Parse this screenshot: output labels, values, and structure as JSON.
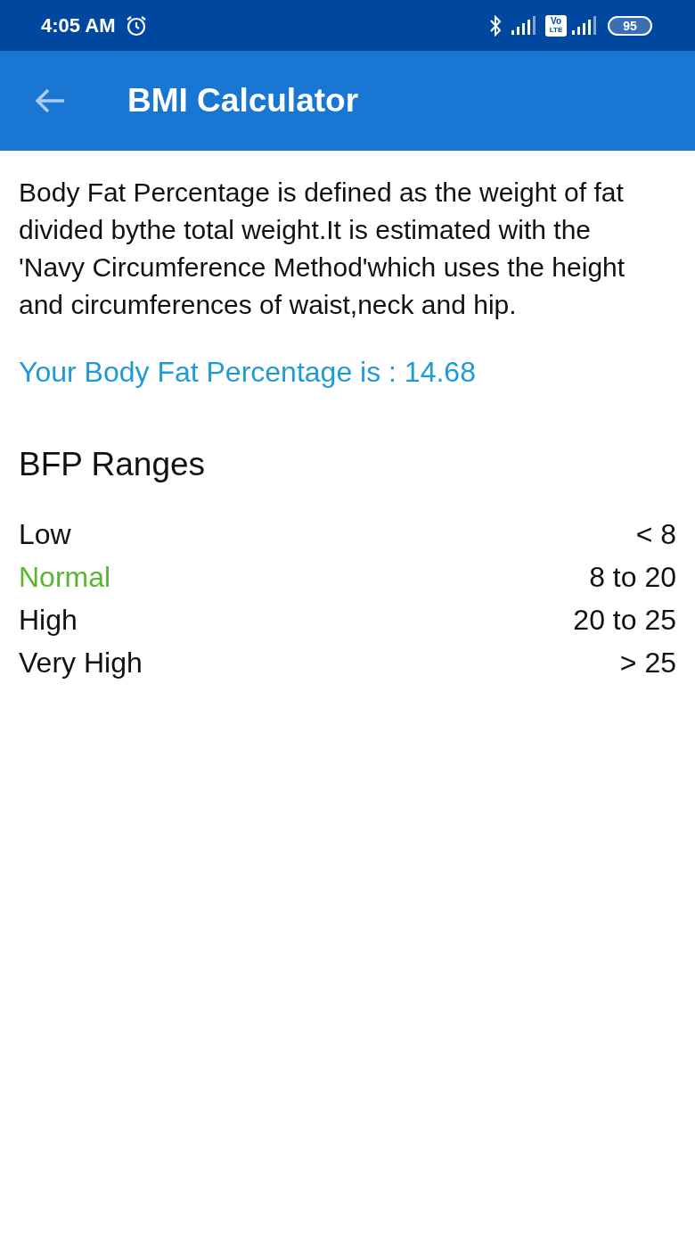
{
  "status_bar": {
    "time": "4:05 AM",
    "network_badge": [
      "Vo",
      "LTE"
    ],
    "battery": "95"
  },
  "app_bar": {
    "title": "BMI Calculator"
  },
  "description": "Body Fat Percentage is defined as the weight of fat divided bythe total weight.It is estimated with the 'Navy Circumference Method'which uses the height and circumferences of waist,neck and hip.",
  "result": "Your Body Fat Percentage is : 14.68",
  "ranges": {
    "title": "BFP Ranges",
    "rows": [
      {
        "label": "Low",
        "value": "< 8",
        "highlighted": false
      },
      {
        "label": "Normal",
        "value": "8 to 20",
        "highlighted": true
      },
      {
        "label": "High",
        "value": "20 to 25",
        "highlighted": false
      },
      {
        "label": "Very High",
        "value": "> 25",
        "highlighted": false
      }
    ]
  }
}
